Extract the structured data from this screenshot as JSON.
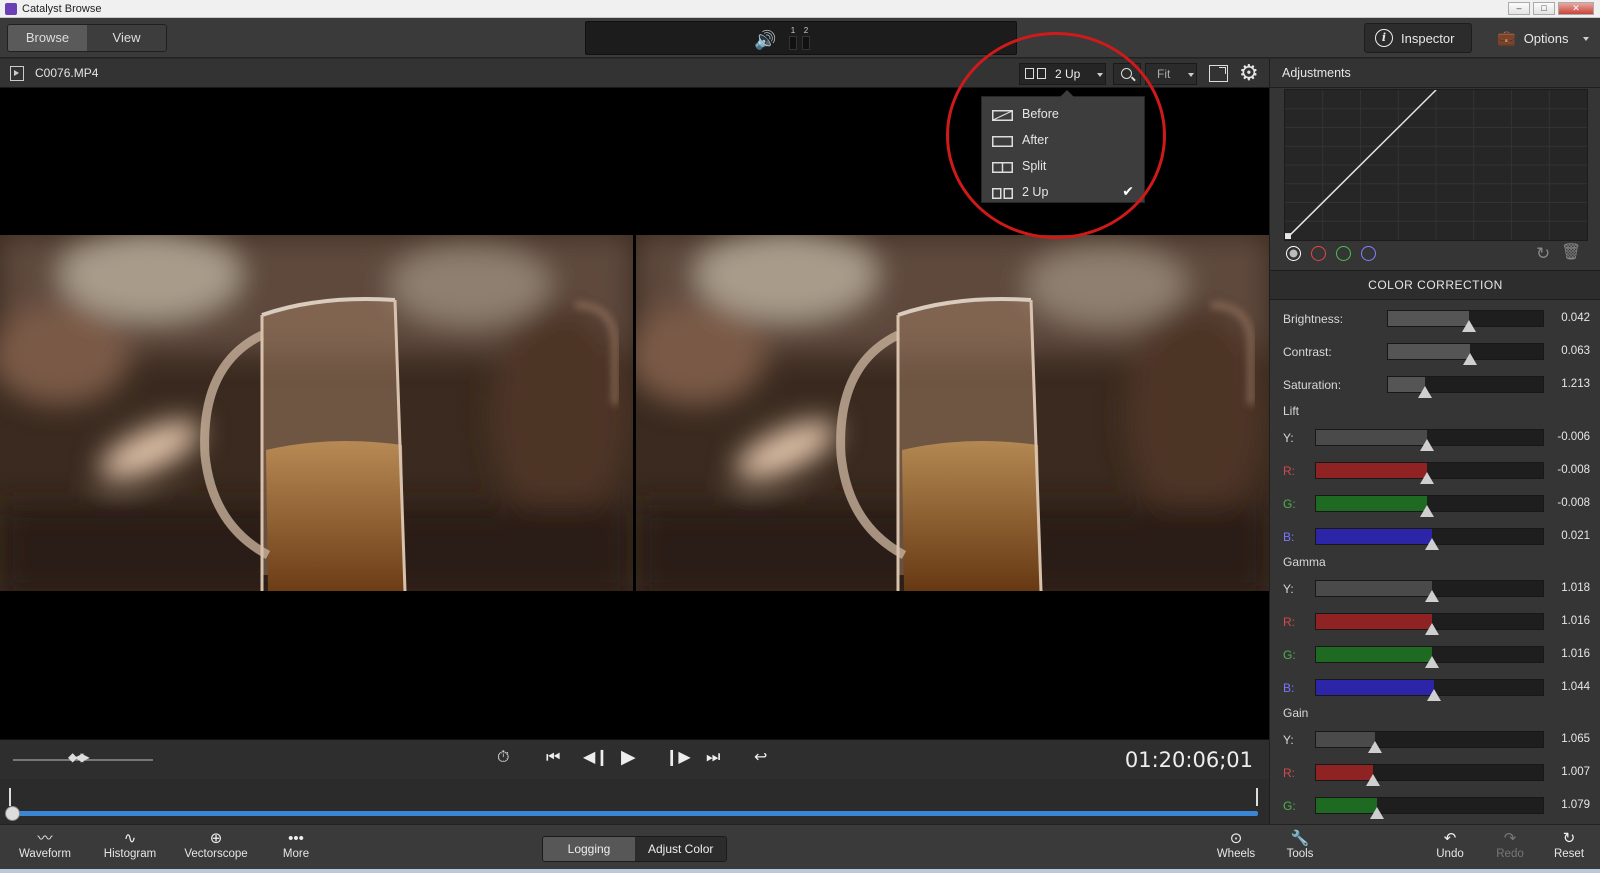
{
  "window": {
    "title": "Catalyst Browse",
    "controls": [
      "–",
      "□",
      "✕"
    ]
  },
  "toolbar": {
    "browse_label": "Browse",
    "view_label": "View",
    "meter_labels": [
      "1",
      "2"
    ],
    "inspector_label": "Inspector",
    "options_label": "Options"
  },
  "clip": {
    "name": "C0076.MP4",
    "view_mode": "2 Up",
    "zoom": "Fit"
  },
  "view_menu": {
    "items": [
      {
        "label": "Before",
        "icon": "before-icon",
        "checked": false
      },
      {
        "label": "After",
        "icon": "after-icon",
        "checked": false
      },
      {
        "label": "Split",
        "icon": "split-icon",
        "checked": false
      },
      {
        "label": "2 Up",
        "icon": "two-up-icon",
        "checked": true
      }
    ]
  },
  "transport": {
    "timecode": "01:20:06;01"
  },
  "bottom": {
    "waveform": "Waveform",
    "histogram": "Histogram",
    "vectorscope": "Vectorscope",
    "more": "More",
    "logging": "Logging",
    "adjust_color": "Adjust Color",
    "wheels": "Wheels",
    "tools": "Tools",
    "undo": "Undo",
    "redo": "Redo",
    "reset": "Reset"
  },
  "adjustments": {
    "title": "Adjustments",
    "section": "COLOR CORRECTION",
    "curve_channels": [
      "#ffffff",
      "#e04848",
      "#48c048",
      "#8080ff"
    ],
    "basic": [
      {
        "label": "Brightness:",
        "value": "0.042",
        "level": 0.52
      },
      {
        "label": "Contrast:",
        "value": "0.063",
        "level": 0.53
      },
      {
        "label": "Saturation:",
        "value": "1.213",
        "level": 0.24
      }
    ],
    "lift_label": "Lift",
    "gamma_label": "Gamma",
    "gain_label": "Gain",
    "lift": [
      {
        "label": "Y:",
        "value": "-0.006",
        "level": 0.49,
        "color": "#4a4a4a"
      },
      {
        "label": "R:",
        "value": "-0.008",
        "level": 0.49,
        "color": "#8f2222"
      },
      {
        "label": "G:",
        "value": "-0.008",
        "level": 0.49,
        "color": "#1f6a22"
      },
      {
        "label": "B:",
        "value": "0.021",
        "level": 0.51,
        "color": "#2c25a8"
      }
    ],
    "gamma": [
      {
        "label": "Y:",
        "value": "1.018",
        "level": 0.51,
        "color": "#4a4a4a"
      },
      {
        "label": "R:",
        "value": "1.016",
        "level": 0.51,
        "color": "#8f2222"
      },
      {
        "label": "G:",
        "value": "1.016",
        "level": 0.51,
        "color": "#1f6a22"
      },
      {
        "label": "B:",
        "value": "1.044",
        "level": 0.52,
        "color": "#2c25a8"
      }
    ],
    "gain": [
      {
        "label": "Y:",
        "value": "1.065",
        "level": 0.26,
        "color": "#4a4a4a"
      },
      {
        "label": "R:",
        "value": "1.007",
        "level": 0.25,
        "color": "#8f2222"
      },
      {
        "label": "G:",
        "value": "1.079",
        "level": 0.27,
        "color": "#1f6a22"
      }
    ]
  }
}
